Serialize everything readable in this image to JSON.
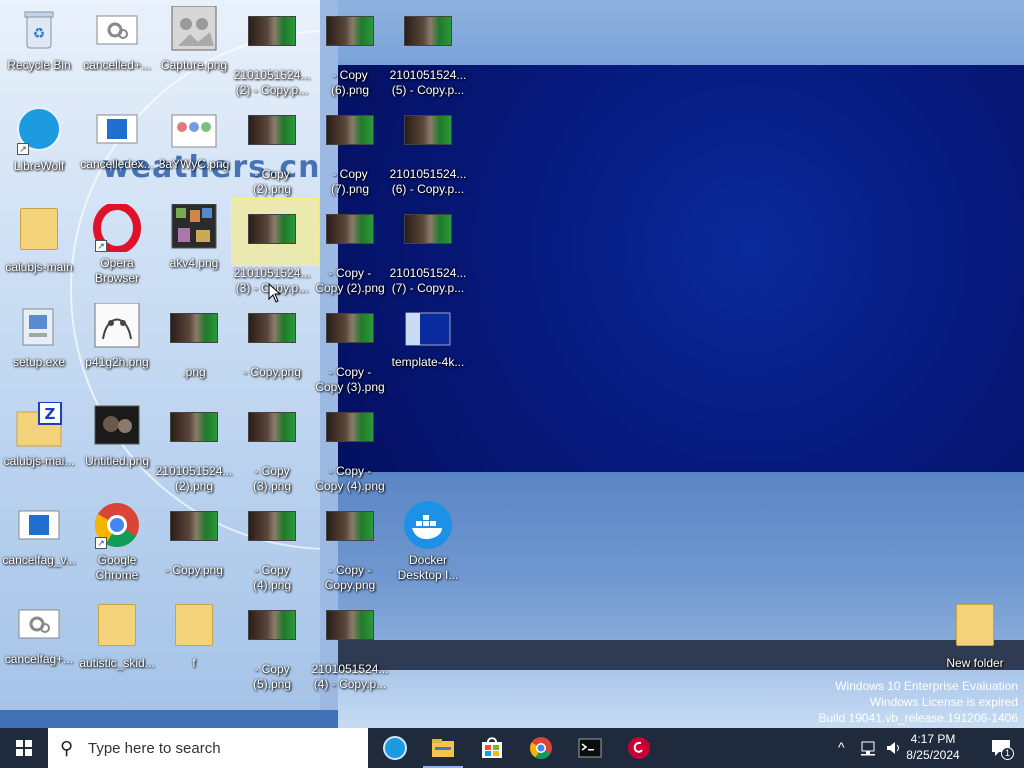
{
  "desktop": {
    "icons": [
      {
        "label": "Recycle Bin"
      },
      {
        "label": "cancelled+..."
      },
      {
        "label": "Capture.png"
      },
      {
        "label": "2101051524...\n(2) - Copy.p..."
      },
      {
        "label": "- Copy\n(6).png"
      },
      {
        "label": "2101051524...\n(5) - Copy.p..."
      },
      {
        "label": "LibreWolf"
      },
      {
        "label": "cancelledex..."
      },
      {
        "label": "8aYWyC.png"
      },
      {
        "label": "- Copy\n(2).png"
      },
      {
        "label": "- Copy\n(7).png"
      },
      {
        "label": "2101051524...\n(6) - Copy.p..."
      },
      {
        "label": "calubjs-main"
      },
      {
        "label": "Opera\nBrowser"
      },
      {
        "label": "akv4.png"
      },
      {
        "label": "2101051524...\n(3) - Copy.p..."
      },
      {
        "label": "- Copy -\nCopy (2).png"
      },
      {
        "label": "2101051524...\n(7) - Copy.p..."
      },
      {
        "label": "setup.exe"
      },
      {
        "label": "p41g2h.png"
      },
      {
        "label": ".png"
      },
      {
        "label": "- Copy.png"
      },
      {
        "label": "- Copy -\nCopy (3).png"
      },
      {
        "label": "template-4k..."
      },
      {
        "label": "calubjs-mai..."
      },
      {
        "label": "Untitled.png"
      },
      {
        "label": "2101051524...\n(2).png"
      },
      {
        "label": "- Copy\n(3).png"
      },
      {
        "label": "- Copy -\nCopy (4).png"
      },
      {
        "label": "cancelfag_v..."
      },
      {
        "label": "Google\nChrome"
      },
      {
        "label": "- Copy.png"
      },
      {
        "label": "- Copy\n(4).png"
      },
      {
        "label": "- Copy -\nCopy.png"
      },
      {
        "label": "Docker\nDesktop I..."
      },
      {
        "label": "cancelfag+..."
      },
      {
        "label": "autistic_skid..."
      },
      {
        "label": "f"
      },
      {
        "label": "- Copy\n(5).png"
      },
      {
        "label": "2101051524...\n(4) - Copy.p..."
      },
      {
        "label": "New folder"
      }
    ]
  },
  "background_text": "weathers.cn",
  "watermark": {
    "line1": "Windows 10 Enterprise Evaluation",
    "line2": "Windows License is expired",
    "line3": "Build 19041.vb_release.191206-1406"
  },
  "taskbar": {
    "search_placeholder": "Type here to search",
    "time": "4:17 PM",
    "date": "8/25/2024",
    "notification_count": "1"
  },
  "colors": {
    "taskbar": "#1f2a3c",
    "selection": "#fff078",
    "dark_window": "#06187a"
  }
}
